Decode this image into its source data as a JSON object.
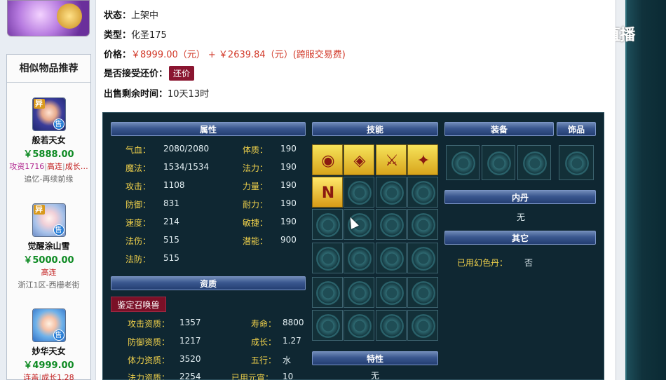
{
  "watermark": {
    "text": "CC直播"
  },
  "similar": {
    "title": "相似物品推荐",
    "items": [
      {
        "name": "般若天女",
        "price": "￥5888.00",
        "tags": [
          "攻资1716",
          "高连",
          "成长…"
        ],
        "sub": "追忆-再续前缘",
        "badge_yi": "异",
        "badge_shou": "售"
      },
      {
        "name": "觉醒涂山雪",
        "price": "￥5000.00",
        "tags": [
          "高连"
        ],
        "sub": "浙江1区-西栅老街",
        "badge_yi": "异",
        "badge_shou": "售"
      },
      {
        "name": "妙华天女",
        "price": "￥4999.00",
        "tags": [
          "连盖",
          "成长1.28"
        ],
        "sub": "",
        "badge_yi": "",
        "badge_shou": "售"
      }
    ]
  },
  "info": {
    "status_label": "状态：",
    "status_value": "上架中",
    "type_label": "类型：",
    "type_value": "化圣175",
    "price_label": "价格：",
    "price_value": "￥8999.00（元） + ￥2639.84（元）(跨服交易费)",
    "bargain_label": "是否接受还价：",
    "bargain_button": "还价",
    "remaining_label": "出售剩余时间：",
    "remaining_value": "10天13时"
  },
  "panel": {
    "headers": {
      "attributes": "属性",
      "skills": "技能",
      "equipment": "装备",
      "accessory": "饰品",
      "neidan": "内丹",
      "other": "其它",
      "aptitude": "资质",
      "traits": "特性"
    },
    "attributes": [
      {
        "k": "气血：",
        "v": "2080/2080"
      },
      {
        "k": "体质：",
        "v": "190"
      },
      {
        "k": "魔法：",
        "v": "1534/1534"
      },
      {
        "k": "法力：",
        "v": "190"
      },
      {
        "k": "攻击：",
        "v": "1108"
      },
      {
        "k": "力量：",
        "v": "190"
      },
      {
        "k": "防御：",
        "v": "831"
      },
      {
        "k": "耐力：",
        "v": "190"
      },
      {
        "k": "速度：",
        "v": "214"
      },
      {
        "k": "敏捷：",
        "v": "190"
      },
      {
        "k": "法伤：",
        "v": "515"
      },
      {
        "k": "潜能：",
        "v": "900"
      },
      {
        "k": "法防：",
        "v": "515"
      }
    ],
    "identify_button": "鉴定召唤兽",
    "aptitude": [
      {
        "k": "攻击资质：",
        "v": "1357"
      },
      {
        "k": "寿命：",
        "v": "8800"
      },
      {
        "k": "防御资质：",
        "v": "1217"
      },
      {
        "k": "成长：",
        "v": "1.27"
      },
      {
        "k": "体力资质：",
        "v": "3520"
      },
      {
        "k": "五行：",
        "v": "水"
      },
      {
        "k": "法力资质：",
        "v": "2254"
      },
      {
        "k": "已用元宵：",
        "v": "10"
      }
    ],
    "neidan_value": "无",
    "other_label": "已用幻色丹：",
    "other_value": "否",
    "traits_value": "无",
    "skills": [
      {
        "icon": "eye-skill-icon",
        "glyph": "◉"
      },
      {
        "icon": "shield-skill-icon",
        "glyph": "◈"
      },
      {
        "icon": "sword-skill-icon",
        "glyph": "⚔"
      },
      {
        "icon": "blade-skill-icon",
        "glyph": "✦"
      },
      {
        "icon": "n-skill-icon",
        "glyph": "N"
      }
    ]
  }
}
